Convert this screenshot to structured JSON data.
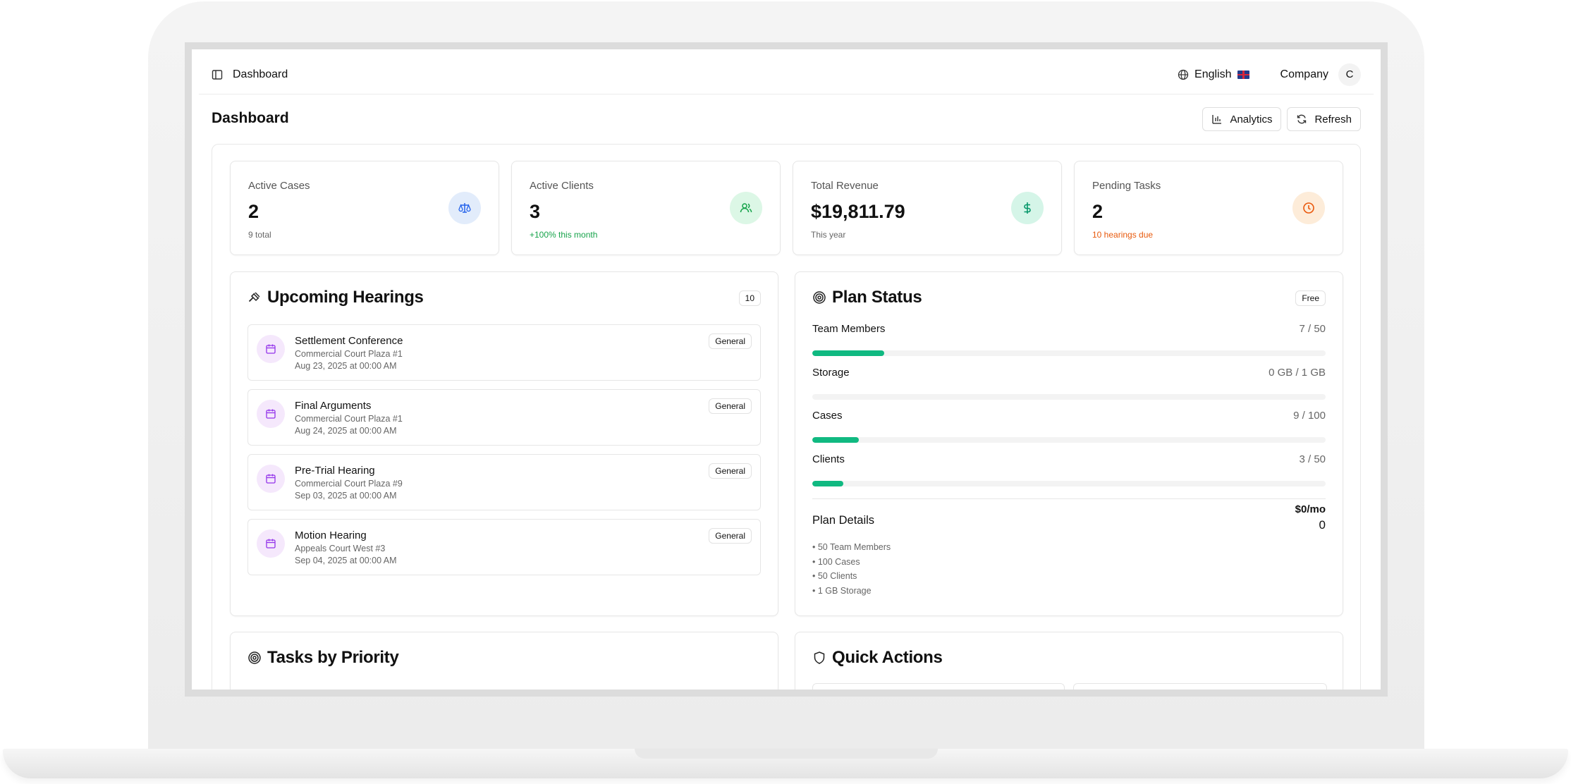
{
  "topbar": {
    "breadcrumb": "Dashboard",
    "language": "English",
    "company": "Company",
    "avatar_initial": "C"
  },
  "header": {
    "title": "Dashboard",
    "analytics_label": "Analytics",
    "refresh_label": "Refresh"
  },
  "stats": [
    {
      "label": "Active Cases",
      "value": "2",
      "sub": "9 total",
      "icon": "scale-icon",
      "color": "#2563eb"
    },
    {
      "label": "Active Clients",
      "value": "3",
      "sub": "+100% this month",
      "icon": "users-icon",
      "color": "#16a34a"
    },
    {
      "label": "Total Revenue",
      "value": "$19,811.79",
      "sub": "This year",
      "icon": "dollar-icon",
      "color": "#059669"
    },
    {
      "label": "Pending Tasks",
      "value": "2",
      "sub": "10 hearings due",
      "icon": "clock-icon",
      "color": "#ea580c"
    }
  ],
  "hearings": {
    "title": "Upcoming Hearings",
    "count": "10",
    "items": [
      {
        "title": "Settlement Conference",
        "location": "Commercial Court Plaza #1",
        "date": "Aug 23, 2025 at 00:00 AM",
        "tag": "General"
      },
      {
        "title": "Final Arguments",
        "location": "Commercial Court Plaza #1",
        "date": "Aug 24, 2025 at 00:00 AM",
        "tag": "General"
      },
      {
        "title": "Pre-Trial Hearing",
        "location": "Commercial Court Plaza #9",
        "date": "Sep 03, 2025 at 00:00 AM",
        "tag": "General"
      },
      {
        "title": "Motion Hearing",
        "location": "Appeals Court West #3",
        "date": "Sep 04, 2025 at 00:00 AM",
        "tag": "General"
      }
    ]
  },
  "plan": {
    "title": "Plan Status",
    "badge": "Free",
    "rows": [
      {
        "label": "Team Members",
        "value": "7 / 50",
        "fraction": 0.14
      },
      {
        "label": "Storage",
        "value": "0 GB / 1 GB",
        "fraction": 0
      },
      {
        "label": "Cases",
        "value": "9 / 100",
        "fraction": 0.09
      },
      {
        "label": "Clients",
        "value": "3 / 50",
        "fraction": 0.06
      }
    ],
    "details_label": "Plan Details",
    "price": "$0/mo",
    "price_sub": "0",
    "features": [
      "• 50 Team Members",
      "• 100 Cases",
      "• 50 Clients",
      "• 1 GB Storage"
    ]
  },
  "tasks": {
    "title": "Tasks by Priority"
  },
  "quick_actions": {
    "title": "Quick Actions"
  },
  "colors": {
    "accent_green": "#10b981",
    "purple": "#9333ea"
  }
}
